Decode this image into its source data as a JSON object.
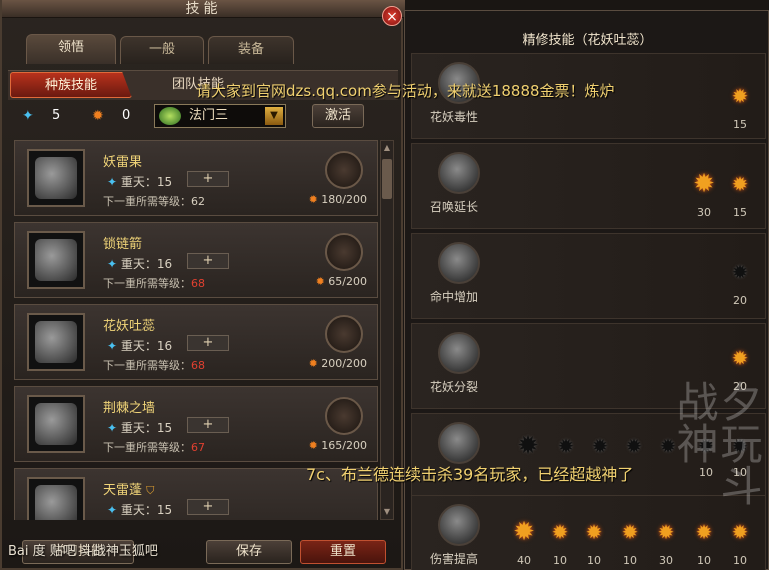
{
  "window": {
    "title": "技能"
  },
  "tabs": [
    {
      "label": "领悟"
    },
    {
      "label": "一般"
    },
    {
      "label": "装备"
    }
  ],
  "subtabs": [
    {
      "label": "种族技能"
    },
    {
      "label": "团队技能"
    }
  ],
  "stats": {
    "blue": "5",
    "fire": "0"
  },
  "dropdown": {
    "value": "法门三"
  },
  "activate_label": "激活",
  "skills": [
    {
      "name": "妖雷果",
      "level_label": "重天：15",
      "next_label": "下一重所需等级：",
      "next_value": "62",
      "cost": "180/200"
    },
    {
      "name": "锁链箭",
      "level_label": "重天：16",
      "next_label": "下一重所需等级：",
      "next_value": "68",
      "cost": "65/200"
    },
    {
      "name": "花妖吐蕊",
      "level_label": "重天：16",
      "next_label": "下一重所需等级：",
      "next_value": "68",
      "cost": "200/200"
    },
    {
      "name": "荆棘之墙",
      "level_label": "重天：15",
      "next_label": "下一重所需等级：",
      "next_value": "67",
      "cost": "165/200"
    },
    {
      "name": "天雷蓬",
      "level_label": "重天：15",
      "next_label": "",
      "next_value": "",
      "cost": ""
    }
  ],
  "bottom": {
    "learn": "学习技能",
    "save": "保存",
    "reset": "重置"
  },
  "refine": {
    "title": "精修技能（花妖吐蕊）",
    "rows": [
      {
        "name": "花妖毒性",
        "stars": [
          {
            "lit": true,
            "value": "15"
          }
        ]
      },
      {
        "name": "召唤延长",
        "stars": [
          {
            "lit": true,
            "value": "30"
          },
          {
            "lit": true,
            "value": "15"
          }
        ]
      },
      {
        "name": "命中增加",
        "stars": [
          {
            "lit": false,
            "value": "20"
          }
        ]
      },
      {
        "name": "花妖分裂",
        "stars": [
          {
            "lit": true,
            "value": "20"
          }
        ]
      },
      {
        "name": "",
        "stars": [
          {
            "lit": false,
            "value": ""
          },
          {
            "lit": false,
            "value": ""
          },
          {
            "lit": false,
            "value": ""
          },
          {
            "lit": false,
            "value": ""
          },
          {
            "lit": false,
            "value": ""
          },
          {
            "lit": false,
            "value": "10"
          },
          {
            "lit": false,
            "value": "10"
          }
        ]
      },
      {
        "name": "伤害提高",
        "stars": [
          {
            "lit": true,
            "value": "40"
          },
          {
            "lit": true,
            "value": "10"
          },
          {
            "lit": true,
            "value": "10"
          },
          {
            "lit": true,
            "value": "10"
          },
          {
            "lit": true,
            "value": "30"
          },
          {
            "lit": true,
            "value": "10"
          },
          {
            "lit": true,
            "value": "10"
          }
        ]
      }
    ]
  },
  "notices": {
    "top": "请大家到官网dzs.qq.com参与活动，来就送18888金票！炼炉",
    "middle": "7c、布兰德连续击杀39名玩家，已经超越神了"
  },
  "watermark": "夕玩斗战神",
  "baidu": "Bai 度 贴吧 斗战神玉狐吧"
}
